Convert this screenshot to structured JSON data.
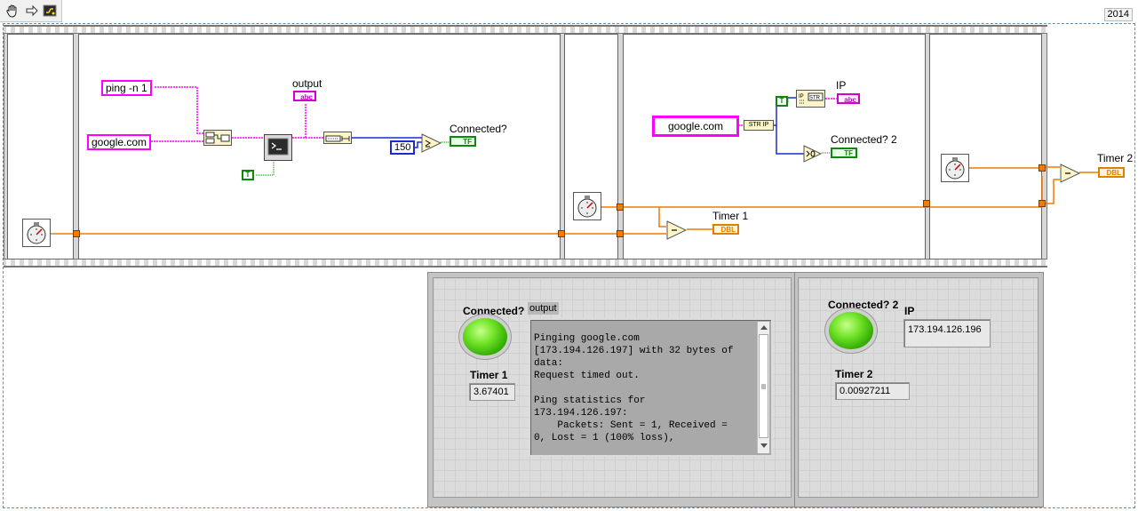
{
  "toolbar": {
    "tools": [
      "hand-tool-icon",
      "arrow-tool-icon",
      "highlight-execution-icon"
    ],
    "version": "2014"
  },
  "diagram": {
    "frame1": {
      "label": "Timer 1"
    },
    "frame2": {
      "cmd_const": "ping -n 1",
      "host_const": "google.com",
      "output_label": "output",
      "output_terminal": "abc",
      "bool_const": "T",
      "number_const": "150",
      "connected_label": "Connected?",
      "tf_terminal": "TF"
    },
    "frame4": {
      "host_const": "google.com",
      "str_ip": "STR IP",
      "ip_label": "IP",
      "ip_terminal": "abc",
      "bool_const": "T",
      "connected2_label": "Connected? 2",
      "tf_terminal": "TF",
      "timer1_label": "Timer 1",
      "dbl_terminal": "DBL"
    },
    "frame5": {
      "timer2_label": "Timer 2",
      "dbl_terminal": "DBL"
    }
  },
  "front_panel": {
    "connected_label": "Connected?",
    "connected_value": true,
    "timer1_label": "Timer 1",
    "timer1_value": "3.67401",
    "output_label": "output",
    "output_text": "Pinging google.com\n[173.194.126.197] with 32 bytes of\ndata:\nRequest timed out.\n\nPing statistics for\n173.194.126.197:\n    Packets: Sent = 1, Received =\n0, Lost = 1 (100% loss),",
    "connected2_label": "Connected? 2",
    "connected2_value": true,
    "ip_label": "IP",
    "ip_value": "173.194.126.196",
    "timer2_label": "Timer 2",
    "timer2_value": "0.00927211"
  },
  "colors": {
    "string_wire": "#ff00ff",
    "numeric_wire": "#f07c00",
    "boolean_wire": "#0a8a0a",
    "integer_wire": "#1a2bd1",
    "led_on": "#5cd21e"
  }
}
